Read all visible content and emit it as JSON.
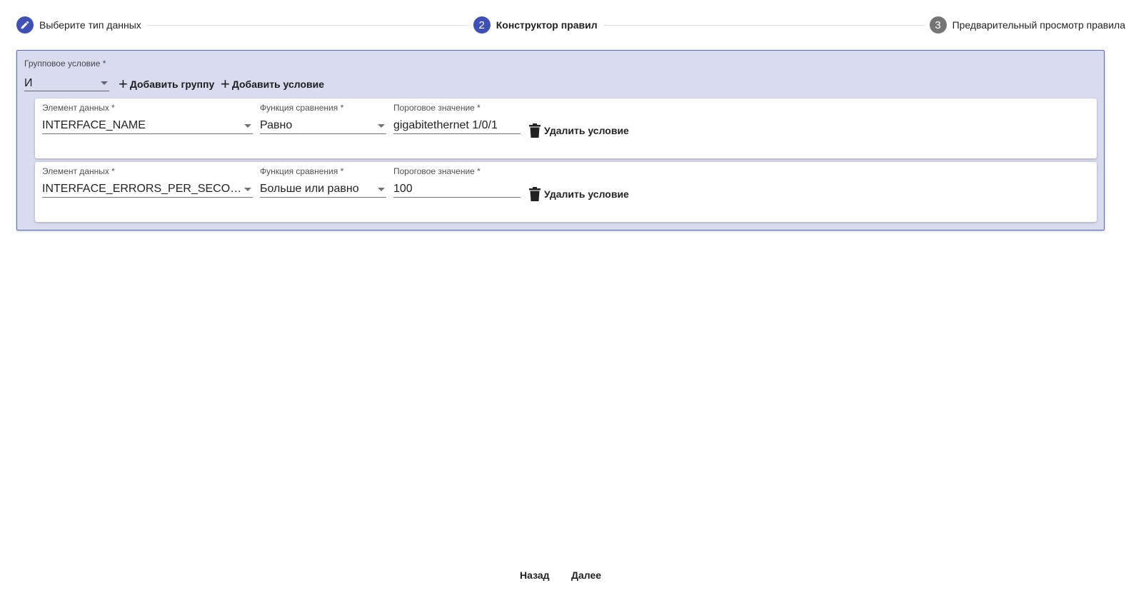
{
  "stepper": {
    "steps": [
      {
        "label": "Выберите тип данных",
        "state": "done",
        "icon": "pencil-icon"
      },
      {
        "label": "Конструктор правил",
        "state": "active",
        "number": "2"
      },
      {
        "label": "Предварительный просмотр правила",
        "state": "inactive",
        "number": "3"
      }
    ]
  },
  "group": {
    "label": "Групповое условие *",
    "value": "И",
    "add_group_label": "Добавить группу",
    "add_condition_label": "Добавить условие"
  },
  "conditions": [
    {
      "element_label": "Элемент данных *",
      "element_value": "INTERFACE_NAME",
      "function_label": "Функция сравнения *",
      "function_value": "Равно",
      "threshold_label": "Пороговое значение *",
      "threshold_value": "gigabitethernet 1/0/1",
      "delete_label": "Удалить условие"
    },
    {
      "element_label": "Элемент данных *",
      "element_value": "INTERFACE_ERRORS_PER_SECONDS_...",
      "function_label": "Функция сравнения *",
      "function_value": "Больше или равно",
      "threshold_label": "Пороговое значение *",
      "threshold_value": "100",
      "delete_label": "Удалить условие"
    }
  ],
  "footer": {
    "back_label": "Назад",
    "next_label": "Далее"
  },
  "colors": {
    "primary": "#3f51b5",
    "inactive_step": "#757575",
    "group_background": "#d9dcef"
  }
}
